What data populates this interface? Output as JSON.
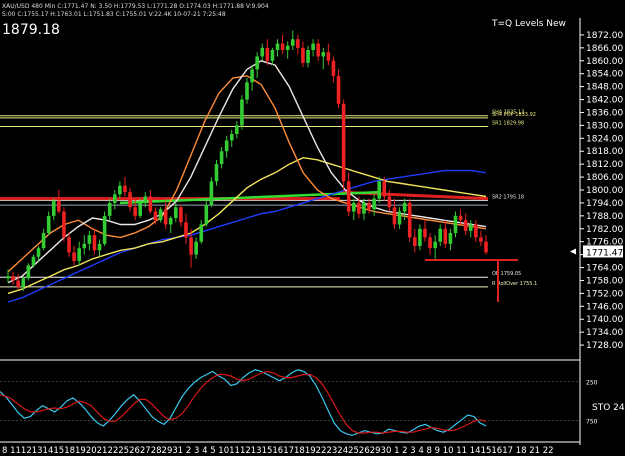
{
  "header": {
    "line1": "XAU/USD 480 Min  C:1771.47  N: 3.50  H:1779.53  L:1771.28  O:1774.03  H:1771.88  V:9,904",
    "line2": "S:00  C:1755.17  H:1763.01  L:1751.83  C:1755.01  V:22.4K  10-07-21  7:25:48",
    "big_value": "1879.18",
    "title": "T=Q Levels New"
  },
  "colors": {
    "background": "#000000",
    "bull": "#33cc33",
    "bear": "#ee2222",
    "axis": "#ffffff",
    "ma_blue": "#1f3cff",
    "ma_yellow": "#f2e45a",
    "ma_orange": "#ff8c3a",
    "ma_white": "#f0e6e6",
    "level_green": "#33dd33",
    "level_red": "#dd2020",
    "stoch_k": "#3ac8f0",
    "stoch_d": "#d81818"
  },
  "chart_data": {
    "type": "candlestick",
    "symbol": "XAU/USD",
    "timeframe": "480 Min",
    "ylim": [
      1722,
      1878
    ],
    "y_ticks": [
      "1872.00",
      "1866.00",
      "1860.00",
      "1854.00",
      "1848.00",
      "1842.00",
      "1836.00",
      "1830.00",
      "1824.00",
      "1818.00",
      "1812.00",
      "1806.00",
      "1800.00",
      "1794.00",
      "1788.00",
      "1782.00",
      "1776.00",
      "1770.00",
      "1764.00",
      "1758.00",
      "1752.00",
      "1746.00",
      "1740.00",
      "1734.00",
      "1728.00"
    ],
    "x_tick_labels": "8  11121314151819202122252627282931  2  3  4  5  10111213151617181922232425262930 1  2  3  4  8  9  10 11 14151617 18  21 22",
    "last_price": "1771.47",
    "candles": [
      [
        1759,
        1763,
        1757,
        1760
      ],
      [
        1760,
        1762,
        1756,
        1758
      ],
      [
        1758,
        1761,
        1754,
        1755
      ],
      [
        1755,
        1760,
        1753,
        1759
      ],
      [
        1759,
        1766,
        1758,
        1765
      ],
      [
        1765,
        1770,
        1764,
        1769
      ],
      [
        1769,
        1774,
        1767,
        1773
      ],
      [
        1773,
        1782,
        1772,
        1780
      ],
      [
        1780,
        1790,
        1779,
        1788
      ],
      [
        1788,
        1796,
        1786,
        1795
      ],
      [
        1795,
        1800,
        1789,
        1790
      ],
      [
        1790,
        1792,
        1776,
        1778
      ],
      [
        1778,
        1780,
        1769,
        1771
      ],
      [
        1771,
        1774,
        1765,
        1767
      ],
      [
        1767,
        1776,
        1765,
        1773
      ],
      [
        1773,
        1779,
        1770,
        1775
      ],
      [
        1775,
        1781,
        1772,
        1779
      ],
      [
        1779,
        1782,
        1770,
        1772
      ],
      [
        1772,
        1777,
        1769,
        1775
      ],
      [
        1775,
        1790,
        1774,
        1788
      ],
      [
        1788,
        1796,
        1786,
        1794
      ],
      [
        1794,
        1800,
        1791,
        1798
      ],
      [
        1798,
        1804,
        1796,
        1802
      ],
      [
        1802,
        1806,
        1797,
        1799
      ],
      [
        1799,
        1801,
        1790,
        1792
      ],
      [
        1792,
        1796,
        1786,
        1788
      ],
      [
        1788,
        1796,
        1787,
        1794
      ],
      [
        1794,
        1799,
        1792,
        1797
      ],
      [
        1797,
        1800,
        1789,
        1790
      ],
      [
        1790,
        1792,
        1784,
        1786
      ],
      [
        1786,
        1792,
        1785,
        1791
      ],
      [
        1791,
        1795,
        1782,
        1784
      ],
      [
        1784,
        1788,
        1780,
        1787
      ],
      [
        1787,
        1794,
        1785,
        1792
      ],
      [
        1792,
        1793,
        1783,
        1785
      ],
      [
        1785,
        1789,
        1775,
        1778
      ],
      [
        1778,
        1782,
        1764,
        1770
      ],
      [
        1770,
        1778,
        1768,
        1776
      ],
      [
        1776,
        1786,
        1775,
        1784
      ],
      [
        1784,
        1795,
        1783,
        1793
      ],
      [
        1793,
        1806,
        1792,
        1804
      ],
      [
        1804,
        1814,
        1802,
        1812
      ],
      [
        1812,
        1820,
        1810,
        1818
      ],
      [
        1818,
        1825,
        1815,
        1823
      ],
      [
        1823,
        1828,
        1820,
        1826
      ],
      [
        1826,
        1832,
        1824,
        1830
      ],
      [
        1830,
        1844,
        1828,
        1842
      ],
      [
        1842,
        1852,
        1840,
        1850
      ],
      [
        1850,
        1858,
        1846,
        1856
      ],
      [
        1856,
        1864,
        1852,
        1862
      ],
      [
        1862,
        1868,
        1860,
        1866
      ],
      [
        1866,
        1870,
        1858,
        1860
      ],
      [
        1860,
        1866,
        1858,
        1865
      ],
      [
        1865,
        1870,
        1862,
        1868
      ],
      [
        1868,
        1872,
        1863,
        1865
      ],
      [
        1865,
        1869,
        1861,
        1867
      ],
      [
        1867,
        1874,
        1865,
        1870
      ],
      [
        1870,
        1872,
        1863,
        1866
      ],
      [
        1866,
        1869,
        1857,
        1859
      ],
      [
        1859,
        1867,
        1857,
        1865
      ],
      [
        1865,
        1870,
        1862,
        1868
      ],
      [
        1868,
        1870,
        1860,
        1862
      ],
      [
        1862,
        1866,
        1856,
        1864
      ],
      [
        1864,
        1868,
        1858,
        1860
      ],
      [
        1860,
        1862,
        1850,
        1853
      ],
      [
        1853,
        1856,
        1838,
        1840
      ],
      [
        1840,
        1842,
        1800,
        1804
      ],
      [
        1804,
        1808,
        1788,
        1790
      ],
      [
        1790,
        1796,
        1786,
        1794
      ],
      [
        1794,
        1797,
        1787,
        1789
      ],
      [
        1789,
        1796,
        1786,
        1794
      ],
      [
        1794,
        1796,
        1789,
        1791
      ],
      [
        1791,
        1798,
        1788,
        1796
      ],
      [
        1796,
        1806,
        1794,
        1804
      ],
      [
        1804,
        1806,
        1795,
        1797
      ],
      [
        1797,
        1800,
        1790,
        1792
      ],
      [
        1792,
        1796,
        1782,
        1784
      ],
      [
        1784,
        1792,
        1782,
        1790
      ],
      [
        1790,
        1796,
        1786,
        1794
      ],
      [
        1794,
        1796,
        1776,
        1778
      ],
      [
        1778,
        1782,
        1771,
        1774
      ],
      [
        1774,
        1784,
        1772,
        1782
      ],
      [
        1782,
        1786,
        1776,
        1778
      ],
      [
        1778,
        1780,
        1770,
        1773
      ],
      [
        1773,
        1779,
        1768,
        1776
      ],
      [
        1776,
        1784,
        1774,
        1782
      ],
      [
        1782,
        1786,
        1773,
        1775
      ],
      [
        1775,
        1782,
        1772,
        1780
      ],
      [
        1780,
        1790,
        1778,
        1788
      ],
      [
        1788,
        1791,
        1784,
        1786
      ],
      [
        1786,
        1789,
        1779,
        1781
      ],
      [
        1781,
        1786,
        1778,
        1784
      ],
      [
        1784,
        1786,
        1776,
        1778
      ],
      [
        1778,
        1781,
        1774,
        1776
      ],
      [
        1776,
        1779,
        1770,
        1771
      ]
    ],
    "moving_averages": [
      {
        "color_key": "ma_blue",
        "values": [
          1748,
          1750,
          1753,
          1756,
          1759,
          1762,
          1765,
          1768,
          1771,
          1773,
          1775,
          1777,
          1778,
          1779,
          1781,
          1783,
          1785,
          1787,
          1789,
          1790,
          1792,
          1794,
          1796,
          1798,
          1800,
          1802,
          1804,
          1805,
          1806,
          1807,
          1808,
          1809,
          1809,
          1809,
          1808
        ]
      },
      {
        "color_key": "ma_yellow",
        "values": [
          1752,
          1754,
          1757,
          1760,
          1763,
          1765,
          1768,
          1770,
          1772,
          1773,
          1775,
          1776,
          1778,
          1780,
          1784,
          1789,
          1795,
          1801,
          1805,
          1808,
          1812,
          1815,
          1814,
          1812,
          1810,
          1808,
          1806,
          1804,
          1803,
          1802,
          1801,
          1800,
          1799,
          1798,
          1797
        ]
      },
      {
        "color_key": "ma_orange",
        "values": [
          1762,
          1768,
          1774,
          1780,
          1784,
          1786,
          1782,
          1779,
          1778,
          1780,
          1783,
          1788,
          1800,
          1816,
          1832,
          1845,
          1852,
          1853,
          1849,
          1838,
          1822,
          1808,
          1800,
          1796,
          1794,
          1792,
          1790,
          1789,
          1788,
          1787,
          1786,
          1785,
          1784,
          1783,
          1782
        ]
      },
      {
        "color_key": "ma_white",
        "values": [
          1757,
          1760,
          1766,
          1772,
          1778,
          1783,
          1787,
          1786,
          1784,
          1784,
          1786,
          1789,
          1795,
          1806,
          1820,
          1834,
          1847,
          1856,
          1860,
          1858,
          1848,
          1834,
          1820,
          1808,
          1800,
          1795,
          1792,
          1790,
          1789,
          1788,
          1787,
          1786,
          1785,
          1784,
          1783
        ]
      }
    ],
    "levels": [
      {
        "value": 1834.5,
        "color": "#e8e880",
        "style": "solid",
        "label": "SH4 1835.13",
        "span": "full"
      },
      {
        "value": 1833.5,
        "color": "#e8e880",
        "style": "solid",
        "label": "SH4 POP 1833.92",
        "span": "full"
      },
      {
        "value": 1829.5,
        "color": "#e8e880",
        "style": "solid",
        "label": "SR1 1829.98",
        "span": "full"
      },
      {
        "value": 1795.2,
        "color": "#e8e8e8",
        "style": "solid",
        "label": "SR2 1795.18",
        "span": "full"
      },
      {
        "value": 1793.0,
        "color": "#9ab",
        "style": "solid",
        "label": "",
        "span": "full"
      },
      {
        "value": 1759.5,
        "color": "#f0f0f0",
        "style": "solid",
        "label": "OP 1759.05",
        "span": "full"
      },
      {
        "value": 1755.0,
        "color": "#f0f0c0",
        "style": "solid",
        "label": "R RollOver 1755.1",
        "span": "full"
      }
    ],
    "stochastic": {
      "label": "STO 24,",
      "ylim": [
        0,
        100
      ],
      "y_ticks": [
        "250",
        "750"
      ],
      "k": [
        62,
        55,
        45,
        35,
        28,
        30,
        38,
        44,
        40,
        36,
        42,
        50,
        54,
        48,
        40,
        30,
        22,
        18,
        25,
        34,
        44,
        52,
        58,
        50,
        40,
        30,
        24,
        20,
        28,
        42,
        56,
        66,
        74,
        80,
        84,
        88,
        82,
        78,
        70,
        72,
        80,
        86,
        90,
        88,
        84,
        80,
        76,
        80,
        86,
        90,
        88,
        82,
        70,
        55,
        38,
        22,
        12,
        8,
        6,
        9,
        12,
        10,
        8,
        9,
        14,
        12,
        10,
        9,
        13,
        18,
        20,
        16,
        12,
        10,
        14,
        20,
        26,
        32,
        30,
        22,
        18
      ],
      "d": [
        58,
        56,
        52,
        46,
        40,
        36,
        36,
        38,
        40,
        41,
        40,
        42,
        46,
        50,
        48,
        44,
        36,
        28,
        24,
        24,
        30,
        38,
        46,
        52,
        52,
        46,
        38,
        30,
        26,
        28,
        34,
        44,
        56,
        66,
        74,
        80,
        84,
        84,
        82,
        78,
        76,
        78,
        82,
        86,
        88,
        86,
        82,
        80,
        80,
        82,
        84,
        84,
        80,
        72,
        60,
        46,
        32,
        20,
        12,
        9,
        9,
        10,
        10,
        9,
        10,
        11,
        11,
        10,
        10,
        12,
        14,
        16,
        15,
        13,
        12,
        13,
        16,
        20,
        24,
        26,
        24
      ]
    }
  }
}
